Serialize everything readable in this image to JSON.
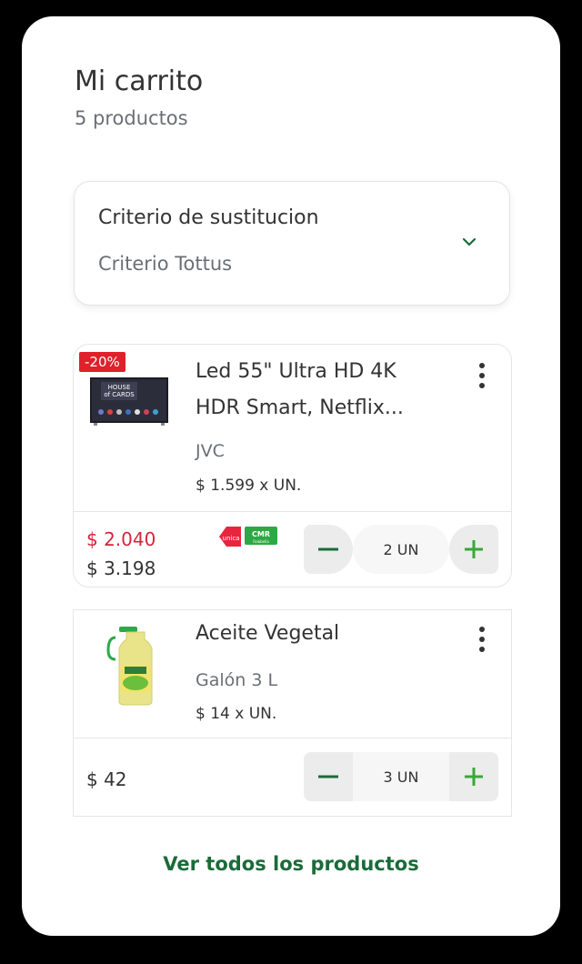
{
  "cart": {
    "title": "Mi carrito",
    "count_label": "5 productos"
  },
  "substitution": {
    "label": "Criterio de sustitucion",
    "value": "Criterio Tottus",
    "icon": "chevron-down-icon"
  },
  "products": [
    {
      "discount_badge": "-20%",
      "name": "Led 55\" Ultra HD 4K HDR Smart, Netflix...",
      "brand": "JVC",
      "unit_price": "$ 1.599 x UN.",
      "offer_price": "$ 2.040",
      "normal_price": "$ 3.198",
      "payment_badges": [
        "unica",
        "CMR"
      ],
      "quantity": "2 UN"
    },
    {
      "name": "Aceite Vegetal",
      "brand": "Galón 3 L",
      "unit_price": "$ 14 x UN.",
      "normal_price": "$ 42",
      "quantity": "3 UN"
    }
  ],
  "footer": {
    "view_all": "Ver todos los productos"
  },
  "colors": {
    "accent_green": "#1b6b3a",
    "plus_green": "#3aa63a",
    "offer_red": "#d4263b",
    "badge_red": "#e0202a"
  }
}
